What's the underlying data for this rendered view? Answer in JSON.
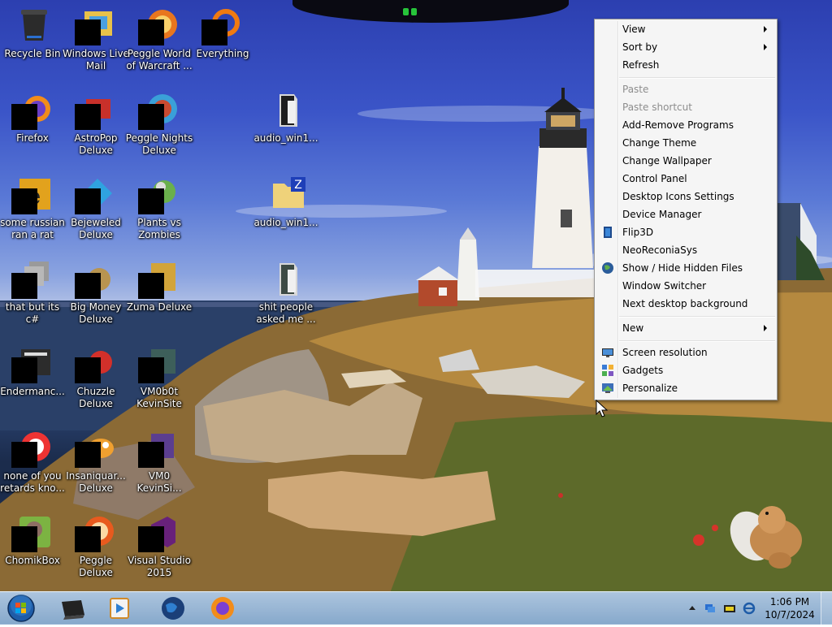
{
  "desktop": {
    "icons": [
      {
        "label": "Recycle Bin",
        "icon": "recycle-bin-icon"
      },
      {
        "label": "Windows Live Mail",
        "icon": "windows-live-mail-icon"
      },
      {
        "label": "Peggle World of Warcraft ...",
        "icon": "peggle-wow-icon"
      },
      {
        "label": "Everything",
        "icon": "everything-search-icon"
      },
      {
        "label": "Firefox",
        "icon": "firefox-icon"
      },
      {
        "label": "AstroPop Deluxe",
        "icon": "astropop-icon"
      },
      {
        "label": "Peggle Nights Deluxe",
        "icon": "peggle-nights-icon"
      },
      {
        "label": "audio_win1...",
        "icon": "folder-icon"
      },
      {
        "label": "some russian ran a rat",
        "icon": "app-icon"
      },
      {
        "label": "Bejeweled Deluxe",
        "icon": "bejeweled-icon"
      },
      {
        "label": "Plants vs Zombies",
        "icon": "plants-vs-zombies-icon"
      },
      {
        "label": "audio_win1...",
        "icon": "zip-folder-icon"
      },
      {
        "label": "that but its c#",
        "icon": "app-icon"
      },
      {
        "label": "Big Money Deluxe",
        "icon": "big-money-icon"
      },
      {
        "label": "Zuma Deluxe",
        "icon": "zuma-icon"
      },
      {
        "label": "shit people asked me ...",
        "icon": "folder-icon"
      },
      {
        "label": "Endermanc...",
        "icon": "app-icon"
      },
      {
        "label": "Chuzzle Deluxe",
        "icon": "chuzzle-icon"
      },
      {
        "label": "VM0b0t KevinSite",
        "icon": "app-icon"
      },
      {
        "label": "none of you retards kno...",
        "icon": "app-icon"
      },
      {
        "label": "Insaniquar... Deluxe",
        "icon": "insaniquarium-icon"
      },
      {
        "label": "VM0 KevinSi...",
        "icon": "app-icon"
      },
      {
        "label": "ChomikBox",
        "icon": "chomikbox-icon"
      },
      {
        "label": "Peggle Deluxe",
        "icon": "peggle-icon"
      },
      {
        "label": "Visual Studio 2015",
        "icon": "visual-studio-icon"
      }
    ]
  },
  "context_menu": {
    "items": [
      {
        "label": "View",
        "submenu": true,
        "enabled": true
      },
      {
        "label": "Sort by",
        "submenu": true,
        "enabled": true
      },
      {
        "label": "Refresh",
        "submenu": false,
        "enabled": true
      },
      {
        "label": "Paste",
        "submenu": false,
        "enabled": false
      },
      {
        "label": "Paste shortcut",
        "submenu": false,
        "enabled": false
      },
      {
        "label": "Add-Remove Programs",
        "submenu": false,
        "enabled": true
      },
      {
        "label": "Change Theme",
        "submenu": false,
        "enabled": true
      },
      {
        "label": "Change Wallpaper",
        "submenu": false,
        "enabled": true
      },
      {
        "label": "Control Panel",
        "submenu": false,
        "enabled": true
      },
      {
        "label": "Desktop Icons Settings",
        "submenu": false,
        "enabled": true
      },
      {
        "label": "Device Manager",
        "submenu": false,
        "enabled": true
      },
      {
        "label": "Flip3D",
        "submenu": false,
        "enabled": true,
        "icon": "flip3d-icon"
      },
      {
        "label": "NeoReconiaSys",
        "submenu": false,
        "enabled": true
      },
      {
        "label": "Show / Hide Hidden Files",
        "submenu": false,
        "enabled": true,
        "icon": "globe-icon"
      },
      {
        "label": "Window Switcher",
        "submenu": false,
        "enabled": true
      },
      {
        "label": "Next desktop background",
        "submenu": false,
        "enabled": true
      },
      {
        "label": "New",
        "submenu": true,
        "enabled": true
      },
      {
        "label": "Screen resolution",
        "submenu": false,
        "enabled": true,
        "icon": "monitor-icon"
      },
      {
        "label": "Gadgets",
        "submenu": false,
        "enabled": true,
        "icon": "gadgets-icon"
      },
      {
        "label": "Personalize",
        "submenu": false,
        "enabled": true,
        "icon": "personalize-icon"
      }
    ]
  },
  "taskbar": {
    "pinned": [
      {
        "name": "start-orb-icon"
      },
      {
        "name": "notebook-icon"
      },
      {
        "name": "media-player-icon"
      },
      {
        "name": "globe-app-icon"
      },
      {
        "name": "firefox-icon"
      }
    ],
    "tray": {
      "time": "1:06 PM",
      "date": "10/7/2024",
      "icons": [
        "show-hidden-icons-icon",
        "network-icon",
        "battery-icon",
        "ie-icon"
      ]
    }
  },
  "colors": {
    "menu_bg": "#f5f5f5",
    "menu_border": "#979797",
    "disabled_text": "#8d8d8d",
    "taskbar": "#a6c2de"
  }
}
